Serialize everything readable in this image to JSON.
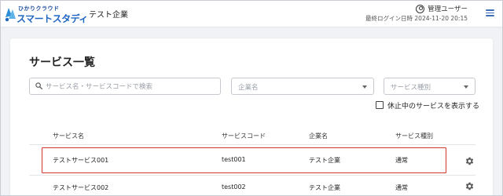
{
  "app": {
    "logo_top": "ひかりクラウド",
    "logo_main": "スマートスタディ",
    "company_name": "テスト企業"
  },
  "user": {
    "name": "管理ユーザー",
    "last_login": "最終ログイン日時 2024-11-20 20:15"
  },
  "page": {
    "title": "サービス一覧"
  },
  "filters": {
    "search_placeholder": "サービス名・サービスコードで検索",
    "company_placeholder": "企業名",
    "type_placeholder": "サービス種別",
    "show_suspended_label": "休止中のサービスを表示する",
    "show_suspended_checked": false
  },
  "table": {
    "columns": [
      "サービス名",
      "サービスコード",
      "企業名",
      "サービス種別"
    ],
    "rows": [
      {
        "name": "テストサービス001",
        "code": "test001",
        "company": "テスト企業",
        "type": "通常"
      },
      {
        "name": "テストサービス002",
        "code": "test002",
        "company": "テスト企業",
        "type": "通常"
      }
    ]
  },
  "colors": {
    "brand": "#1f66c1",
    "highlight": "#d3382f",
    "menu": "#3e6fb6"
  },
  "icons": {
    "user": "user-circle-icon",
    "menu": "hamburger-menu-icon",
    "search": "search-icon",
    "dropdown": "caret-down-icon",
    "row_action": "gear-icon"
  }
}
